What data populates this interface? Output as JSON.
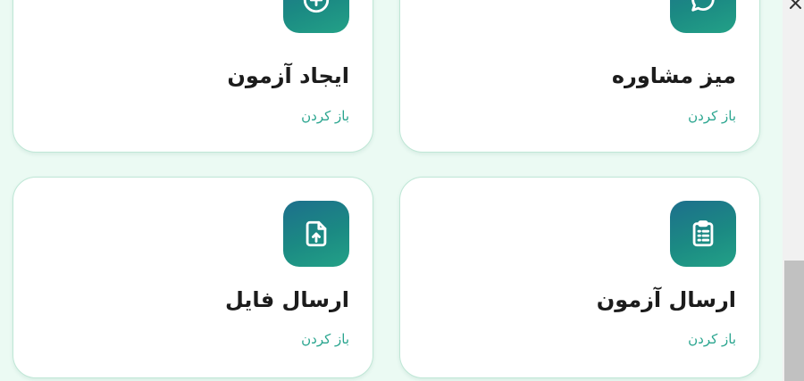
{
  "cards": [
    {
      "title": "میز مشاوره",
      "link": "باز کردن",
      "icon": "chat-bubble-icon"
    },
    {
      "title": "ایجاد آزمون",
      "link": "باز کردن",
      "icon": "plus-circle-icon"
    },
    {
      "title": "ارسال آزمون",
      "link": "باز کردن",
      "icon": "clipboard-list-icon"
    },
    {
      "title": "ارسال فایل",
      "link": "باز کردن",
      "icon": "file-upload-icon"
    }
  ],
  "colors": {
    "background": "#ebfaf3",
    "accent": "#2aa58f",
    "icon_gradient_start": "#1d6f8c",
    "icon_gradient_end": "#23a187"
  }
}
